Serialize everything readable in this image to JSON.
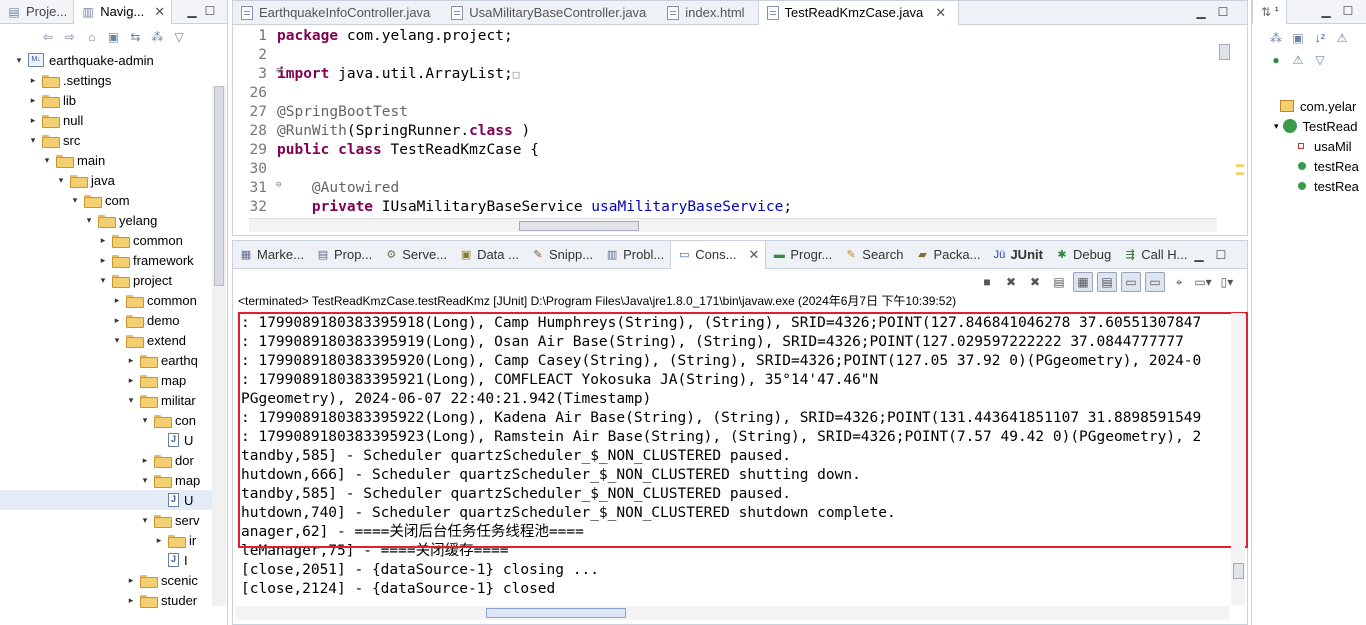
{
  "left_pane": {
    "tabs": [
      {
        "label": "Proje..."
      },
      {
        "label": "Navig...",
        "close": "✕"
      }
    ],
    "tree": [
      {
        "depth": 0,
        "twisty": "▾",
        "icon": "project",
        "label": "earthquake-admin"
      },
      {
        "depth": 1,
        "twisty": "▸",
        "icon": "folder",
        "label": ".settings"
      },
      {
        "depth": 1,
        "twisty": "▸",
        "icon": "folder",
        "label": "lib"
      },
      {
        "depth": 1,
        "twisty": "▸",
        "icon": "folder",
        "label": "null"
      },
      {
        "depth": 1,
        "twisty": "▾",
        "icon": "folder",
        "label": "src"
      },
      {
        "depth": 2,
        "twisty": "▾",
        "icon": "folder",
        "label": "main"
      },
      {
        "depth": 3,
        "twisty": "▾",
        "icon": "folder",
        "label": "java"
      },
      {
        "depth": 4,
        "twisty": "▾",
        "icon": "folder",
        "label": "com"
      },
      {
        "depth": 5,
        "twisty": "▾",
        "icon": "folder",
        "label": "yelang"
      },
      {
        "depth": 6,
        "twisty": "▸",
        "icon": "folder",
        "label": "common"
      },
      {
        "depth": 6,
        "twisty": "▸",
        "icon": "folder",
        "label": "framework"
      },
      {
        "depth": 6,
        "twisty": "▾",
        "icon": "folder",
        "label": "project"
      },
      {
        "depth": 7,
        "twisty": "▸",
        "icon": "folder",
        "label": "common"
      },
      {
        "depth": 7,
        "twisty": "▸",
        "icon": "folder",
        "label": "demo"
      },
      {
        "depth": 7,
        "twisty": "▾",
        "icon": "folder",
        "label": "extend"
      },
      {
        "depth": 8,
        "twisty": "▸",
        "icon": "folder",
        "label": "earthq"
      },
      {
        "depth": 8,
        "twisty": "▸",
        "icon": "folder",
        "label": "map"
      },
      {
        "depth": 8,
        "twisty": "▾",
        "icon": "folder",
        "label": "militar"
      },
      {
        "depth": 9,
        "twisty": "▾",
        "icon": "folder",
        "label": "con"
      },
      {
        "depth": 10,
        "twisty": "",
        "icon": "file",
        "label": "U"
      },
      {
        "depth": 9,
        "twisty": "▸",
        "icon": "folder",
        "label": "dor"
      },
      {
        "depth": 9,
        "twisty": "▾",
        "icon": "folder",
        "label": "map"
      },
      {
        "depth": 10,
        "twisty": "",
        "icon": "file",
        "label": "U",
        "selected": true
      },
      {
        "depth": 9,
        "twisty": "▾",
        "icon": "folder",
        "label": "serv"
      },
      {
        "depth": 10,
        "twisty": "▸",
        "icon": "folder",
        "label": "ir"
      },
      {
        "depth": 10,
        "twisty": "",
        "icon": "file",
        "label": "I"
      },
      {
        "depth": 8,
        "twisty": "▸",
        "icon": "folder",
        "label": "scenic"
      },
      {
        "depth": 8,
        "twisty": "▸",
        "icon": "folder",
        "label": "studer"
      }
    ]
  },
  "editor": {
    "tabs": [
      {
        "label": "EarthquakeInfoController.java",
        "active": false
      },
      {
        "label": "UsaMilitaryBaseController.java",
        "active": false
      },
      {
        "label": "index.html",
        "active": false
      },
      {
        "label": "TestReadKmzCase.java",
        "active": true,
        "close": "✕"
      }
    ],
    "lines": [
      {
        "n": "1",
        "tokens": [
          [
            "kw",
            "package"
          ],
          [
            "",
            "com.yelang.project;"
          ]
        ]
      },
      {
        "n": "2",
        "tokens": []
      },
      {
        "n": "3",
        "fold": "⊕",
        "tokens": [
          [
            "kw",
            "import"
          ],
          [
            "",
            "java.util.ArrayList;"
          ]
        ],
        "ellipsis": "□"
      },
      {
        "n": "26",
        "tokens": []
      },
      {
        "n": "27",
        "tokens": [
          [
            "ann",
            "@SpringBootTest"
          ]
        ]
      },
      {
        "n": "28",
        "tokens": [
          [
            "ann",
            "@RunWith"
          ],
          [
            "",
            "(SpringRunner."
          ],
          [
            "kw",
            "class"
          ],
          [
            "",
            ")"
          ]
        ]
      },
      {
        "n": "29",
        "tokens": [
          [
            "kw",
            "public"
          ],
          [
            "kw",
            "class"
          ],
          [
            "",
            "TestReadKmzCase {"
          ]
        ]
      },
      {
        "n": "30",
        "tokens": []
      },
      {
        "n": "31",
        "fold": "⊖",
        "tokens": [
          [
            "",
            "    "
          ],
          [
            "ann",
            "@Autowired"
          ]
        ]
      },
      {
        "n": "32",
        "tokens": [
          [
            "",
            "    "
          ],
          [
            "kw",
            "private"
          ],
          [
            "",
            "IUsaMilitaryBaseService"
          ],
          [
            "fld",
            "usaMilitaryBaseService"
          ],
          [
            "",
            ";"
          ]
        ]
      }
    ]
  },
  "console": {
    "tabs": [
      {
        "label": "Marke...",
        "icon": "markers-icon",
        "glyph": "▦",
        "color": "#5a6b8c"
      },
      {
        "label": "Prop...",
        "icon": "properties-icon",
        "glyph": "▤",
        "color": "#5a6b8c"
      },
      {
        "label": "Serve...",
        "icon": "servers-icon",
        "glyph": "⚙",
        "color": "#6a7a55"
      },
      {
        "label": "Data ...",
        "icon": "data-source-icon",
        "glyph": "▣",
        "color": "#8a7a2a"
      },
      {
        "label": "Snipp...",
        "icon": "snippets-icon",
        "glyph": "✎",
        "color": "#7a5a3a"
      },
      {
        "label": "Probl...",
        "icon": "problems-icon",
        "glyph": "▥",
        "color": "#5a6b8c"
      },
      {
        "label": "Cons...",
        "icon": "console-icon",
        "glyph": "▭",
        "color": "#3a6aa8",
        "active": true,
        "close": "✕"
      },
      {
        "label": "Progr...",
        "icon": "progress-icon",
        "glyph": "▬",
        "color": "#3a8a4a"
      },
      {
        "label": "Search",
        "icon": "search-icon",
        "glyph": "✎",
        "color": "#c08a1a"
      },
      {
        "label": "Packa...",
        "icon": "package-icon",
        "glyph": "▰",
        "color": "#8a6a2a"
      },
      {
        "label": "JUnit",
        "icon": "junit-icon",
        "glyph": "Jü",
        "color": "#2a4ab8",
        "bold": true
      },
      {
        "label": "Debug",
        "icon": "debug-icon",
        "glyph": "✱",
        "color": "#2a8a3a"
      },
      {
        "label": "Call H...",
        "icon": "call-hierarchy-icon",
        "glyph": "⇶",
        "color": "#2a6a2a"
      }
    ],
    "terminated": "<terminated> TestReadKmzCase.testReadKmz [JUnit] D:\\Program Files\\Java\\jre1.8.0_171\\bin\\javaw.exe (2024年6月7日 下午10:39:52)",
    "output": [
      ": 1799089180383395918(Long), Camp Humphreys(String), (String), SRID=4326;POINT(127.846841046278 37.60551307847",
      ": 1799089180383395919(Long), Osan Air Base(String), (String), SRID=4326;POINT(127.029597222222 37.0844777777",
      ": 1799089180383395920(Long), Camp Casey(String), (String), SRID=4326;POINT(127.05 37.92 0)(PGgeometry), 2024-0",
      ": 1799089180383395921(Long), COMFLEACT Yokosuka JA(String), 35°14'47.46\"N",
      "PGgeometry), 2024-06-07 22:40:21.942(Timestamp)",
      ": 1799089180383395922(Long), Kadena Air Base(String), (String), SRID=4326;POINT(131.443641851107 31.8898591549",
      ": 1799089180383395923(Long), Ramstein Air Base(String), (String), SRID=4326;POINT(7.57 49.42 0)(PGgeometry), 2",
      "tandby,585] - Scheduler quartzScheduler_$_NON_CLUSTERED paused.",
      "hutdown,666] - Scheduler quartzScheduler_$_NON_CLUSTERED shutting down.",
      "tandby,585] - Scheduler quartzScheduler_$_NON_CLUSTERED paused.",
      "hutdown,740] - Scheduler quartzScheduler_$_NON_CLUSTERED shutdown complete.",
      "anager,62] - ====关闭后台任务任务线程池====",
      "leManager,75] - ====关闭缓存====",
      "[close,2051] - {dataSource-1} closing ...",
      "[close,2124] - {dataSource-1} closed"
    ]
  },
  "outline": {
    "tab_label": "¹",
    "rows": [
      {
        "label": "com.yelar",
        "icon": "package-icon",
        "twisty": ""
      },
      {
        "label": "TestRead",
        "icon": "class-icon",
        "twisty": "▾"
      },
      {
        "label": "usaMil",
        "icon": "field-icon",
        "twisty": ""
      },
      {
        "label": "testRea",
        "icon": "method-icon",
        "twisty": "",
        "selected": true
      },
      {
        "label": "testRea",
        "icon": "method-icon",
        "twisty": ""
      }
    ]
  },
  "colors": {
    "keyword": "#7f0055",
    "annotation": "#646464",
    "field": "#0000c0",
    "highlight_box": "#e0202a"
  }
}
